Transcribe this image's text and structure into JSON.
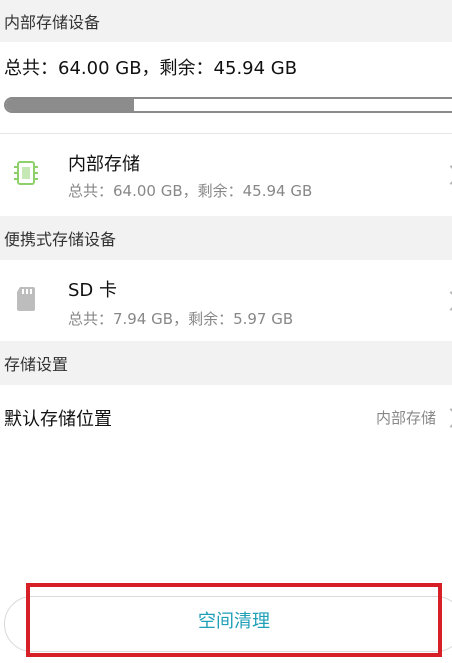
{
  "sections": {
    "internal_header": "内部存储设备",
    "portable_header": "便携式存储设备",
    "settings_header": "存储设置"
  },
  "internal_summary": {
    "text": "总共：64.00 GB，剩余：45.94 GB",
    "used_fraction": 0.28
  },
  "internal_storage": {
    "title": "内部存储",
    "subtitle": "总共：64.00 GB，剩余：45.94 GB",
    "icon": "chip-icon"
  },
  "sd_card": {
    "title": "SD 卡",
    "subtitle": "总共：7.94 GB，剩余：5.97 GB",
    "icon": "sd-card-icon"
  },
  "default_location": {
    "label": "默认存储位置",
    "value": "内部存储"
  },
  "clean_button": {
    "label": "空间清理"
  },
  "colors": {
    "accent_text": "#1f9fb8",
    "highlight_border": "#d61f26",
    "chip_icon": "#8ed16b",
    "progress_fill": "#8c8c8c"
  }
}
